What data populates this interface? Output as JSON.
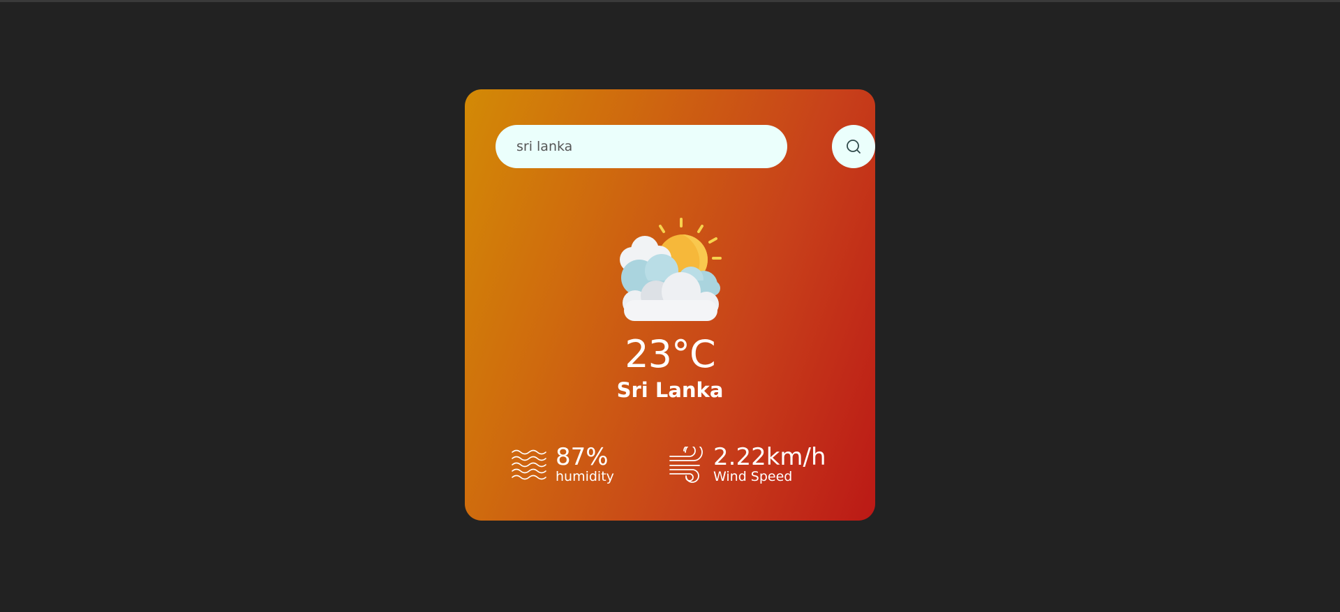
{
  "search": {
    "value": "sri lanka",
    "button_icon": "search-icon"
  },
  "weather": {
    "icon": "partly-cloudy-sun-icon",
    "temperature": "23°C",
    "city": "Sri Lanka"
  },
  "stats": {
    "humidity": {
      "icon": "humidity-waves-icon",
      "value": "87%",
      "label": "humidity"
    },
    "wind": {
      "icon": "wind-icon",
      "value": "2.22km/h",
      "label": "Wind Speed"
    }
  },
  "colors": {
    "background": "#222222",
    "card_gradient_start": "#d38a06",
    "card_gradient_end": "#bb1916",
    "input_background": "#ebfffc",
    "text": "#ffffff"
  }
}
